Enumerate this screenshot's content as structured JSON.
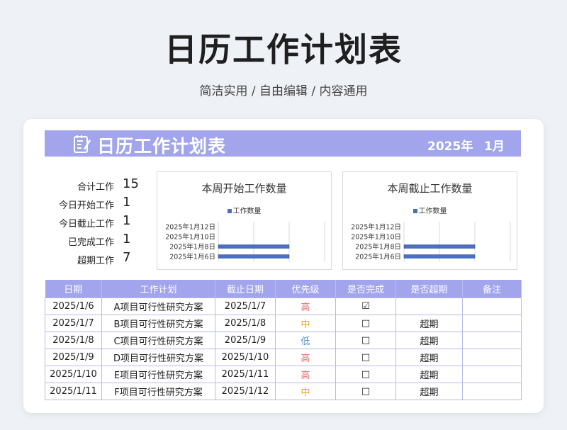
{
  "hero": {
    "title": "日历工作计划表",
    "subtitle": "简洁实用 / 自由编辑 / 内容通用"
  },
  "banner": {
    "title": "日历工作计划表",
    "year": "2025年",
    "month": "1月"
  },
  "summary": [
    {
      "label": "合计工作",
      "value": "15"
    },
    {
      "label": "今日开始工作",
      "value": "1"
    },
    {
      "label": "今日截止工作",
      "value": "1"
    },
    {
      "label": "已完成工作",
      "value": "1"
    },
    {
      "label": "超期工作",
      "value": "7"
    }
  ],
  "chart_data": [
    {
      "type": "bar",
      "title": "本周开始工作数量",
      "categories": [
        "2025年1月6日",
        "2025年1月8日",
        "2025年1月10日",
        "2025年1月12日"
      ],
      "series": [
        {
          "name": "工作数量",
          "values": [
            1,
            1,
            0,
            0
          ]
        }
      ],
      "xlim": [
        0,
        1.5
      ]
    },
    {
      "type": "bar",
      "title": "本周截止工作数量",
      "categories": [
        "2025年1月6日",
        "2025年1月8日",
        "2025年1月10日",
        "2025年1月12日"
      ],
      "series": [
        {
          "name": "工作数量",
          "values": [
            1,
            1,
            0,
            0
          ]
        }
      ],
      "xlim": [
        0,
        1.5
      ]
    }
  ],
  "table": {
    "headers": [
      "日期",
      "工作计划",
      "截止日期",
      "优先级",
      "是否完成",
      "是否超期",
      "备注"
    ],
    "rows": [
      [
        "2025/1/6",
        "A项目可行性研究方案",
        "2025/1/7",
        "高",
        "☑",
        "",
        ""
      ],
      [
        "2025/1/7",
        "B项目可行性研究方案",
        "2025/1/8",
        "中",
        "□",
        "超期",
        ""
      ],
      [
        "2025/1/8",
        "C项目可行性研究方案",
        "2025/1/9",
        "低",
        "□",
        "超期",
        ""
      ],
      [
        "2025/1/9",
        "D项目可行性研究方案",
        "2025/1/10",
        "高",
        "□",
        "超期",
        ""
      ],
      [
        "2025/1/10",
        "E项目可行性研究方案",
        "2025/1/11",
        "高",
        "□",
        "超期",
        ""
      ],
      [
        "2025/1/11",
        "F项目可行性研究方案",
        "2025/1/12",
        "中",
        "□",
        "超期",
        ""
      ]
    ]
  },
  "colors": {
    "accent": "#a2a5ec",
    "bar": "#4a6fc4",
    "high": "#e86b6b",
    "mid": "#e7a417",
    "low": "#4a90d9"
  }
}
